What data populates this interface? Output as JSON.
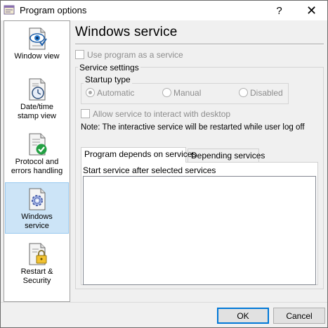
{
  "window": {
    "title": "Program options",
    "help_glyph": "?",
    "close_glyph": "✕"
  },
  "sidebar": {
    "items": [
      {
        "label": "Window view",
        "icon": "eye-document-icon",
        "selected": false
      },
      {
        "label": "Date/time stamp view",
        "icon": "clock-document-icon",
        "selected": false
      },
      {
        "label": "Protocol and errors handling",
        "icon": "checkmark-document-icon",
        "selected": false
      },
      {
        "label": "Windows service",
        "icon": "gear-document-icon",
        "selected": true
      },
      {
        "label": "Restart & Security",
        "icon": "lock-document-icon",
        "selected": false
      }
    ]
  },
  "main": {
    "title": "Windows service",
    "use_as_service": {
      "label": "Use program as a service",
      "checked": false,
      "enabled": false
    },
    "service_settings": {
      "label": "Service settings",
      "startup_type": {
        "label": "Startup type",
        "options": [
          {
            "label": "Automatic",
            "selected": true
          },
          {
            "label": "Manual",
            "selected": false
          },
          {
            "label": "Disabled",
            "selected": false
          }
        ]
      },
      "allow_interact": {
        "label": "Allow service to interact with desktop",
        "checked": false
      },
      "note": "Note: The interactive service will be restarted while user log off"
    },
    "tabs": [
      {
        "label": "Program depends on services",
        "active": true
      },
      {
        "label": "Depending services",
        "active": false
      }
    ],
    "tab_content": {
      "caption": "Start service after selected services",
      "items": []
    }
  },
  "footer": {
    "ok_label": "OK",
    "cancel_label": "Cancel"
  },
  "colors": {
    "selection_bg": "#cce4f7",
    "selection_border": "#99c9ef",
    "accent": "#0078d7",
    "disabled_text": "#8d8d8d"
  }
}
